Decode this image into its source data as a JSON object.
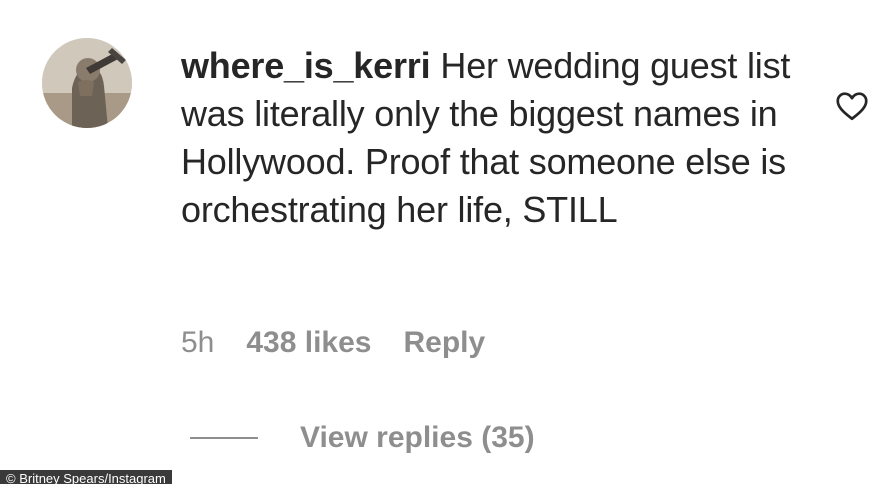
{
  "comment": {
    "username": "where_is_kerri",
    "text": "Her wedding guest list was literally only the biggest names in Hollywood. Proof that someone else is orchestrating her life, STILL",
    "time": "5h",
    "likes": "438 likes",
    "reply_label": "Reply",
    "view_replies": "View replies (35)",
    "like_icon": "heart-outline-icon",
    "avatar_icon": "avatar"
  },
  "credit": "© Britney Spears/Instagram",
  "colors": {
    "text": "#262626",
    "muted": "#8e8e8e",
    "background": "#ffffff"
  }
}
